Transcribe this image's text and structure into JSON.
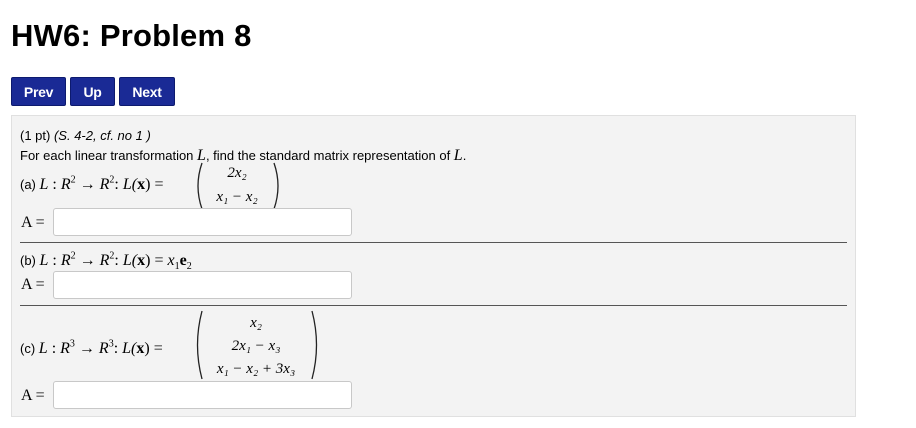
{
  "page": {
    "title": "HW6: Problem 8"
  },
  "nav": {
    "prev": "Prev",
    "up": "Up",
    "next": "Next"
  },
  "problem": {
    "meta_points": "(1 pt) ",
    "meta_source": "(S. 4-2, cf. no 1 )",
    "instruction_prefix": "For each linear transformation ",
    "instruction_var": "L",
    "instruction_suffix": ", find the standard matrix representation of ",
    "instruction_var2": "L",
    "instruction_end": ".",
    "answer_label": "A =",
    "parts": [
      {
        "tag": "(a) ",
        "map_L": "L",
        "map_colon": " : ",
        "map_R": "R",
        "map_dim_in": "2",
        "map_arrow": " → ",
        "map_R2": "R",
        "map_dim_out": "2",
        "map_colon2": ": ",
        "map_Lx": "L(",
        "map_x": "x",
        "map_eq": ") =",
        "matrix_rows": [
          "2x₂",
          "x₁ − x₂"
        ]
      },
      {
        "tag": "(b) ",
        "map_L": "L",
        "map_colon": " : ",
        "map_R": "R",
        "map_dim_in": "2",
        "map_arrow": " → ",
        "map_R2": "R",
        "map_dim_out": "2",
        "map_colon2": ": ",
        "map_Lx": "L(",
        "map_x": "x",
        "map_eq": ") = ",
        "rhs_x": "x",
        "rhs_sub": "1",
        "rhs_e": "e",
        "rhs_esub": "2"
      },
      {
        "tag": "(c) ",
        "map_L": "L",
        "map_colon": " : ",
        "map_R": "R",
        "map_dim_in": "3",
        "map_arrow": " → ",
        "map_R2": "R",
        "map_dim_out": "3",
        "map_colon2": ": ",
        "map_Lx": "L(",
        "map_x": "x",
        "map_eq": ") =",
        "matrix_rows": [
          "x₂",
          "2x₁ − x₃",
          "x₁ − x₂ + 3x₃"
        ]
      }
    ],
    "inputs": [
      "",
      "",
      ""
    ]
  }
}
